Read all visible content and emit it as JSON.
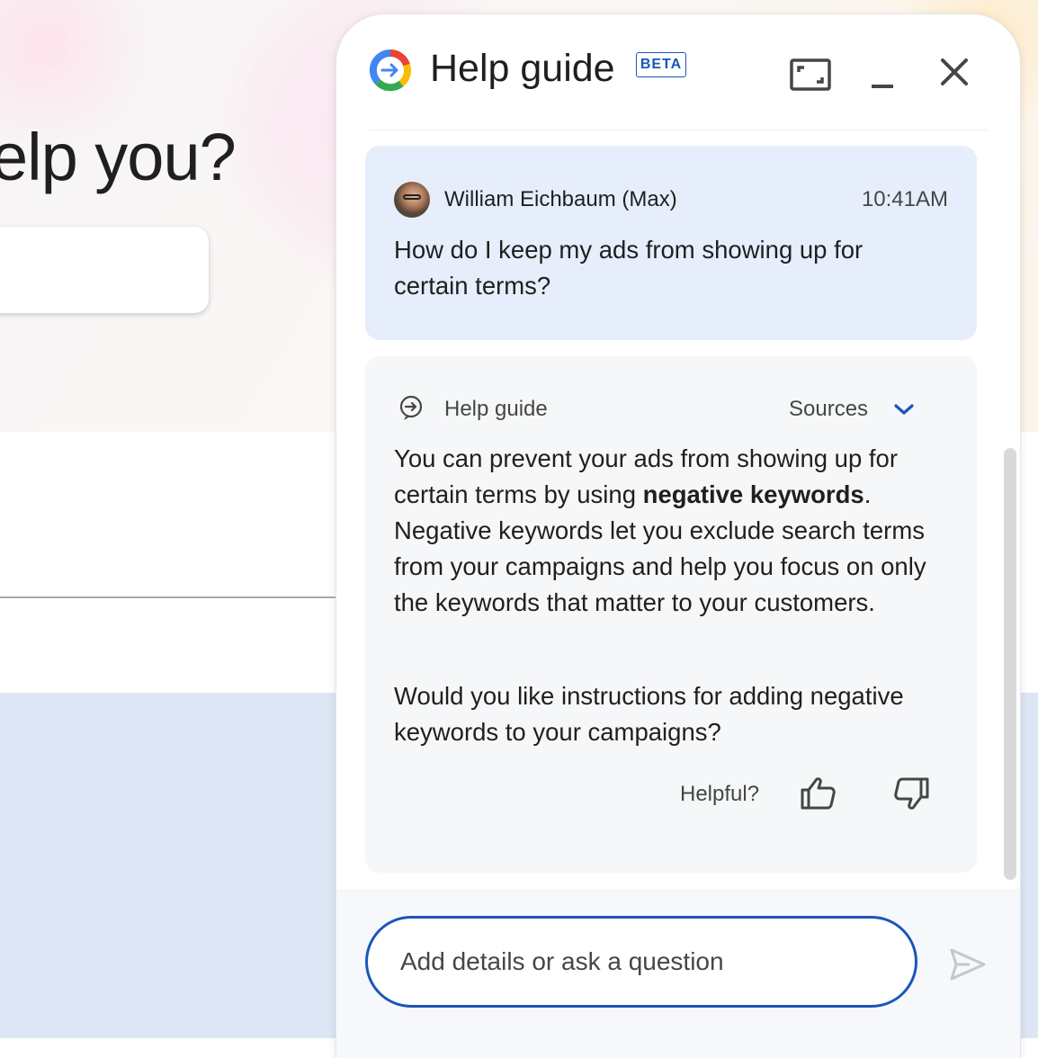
{
  "background": {
    "heading": "elp you?"
  },
  "panel": {
    "title": "Help guide",
    "badge": "BETA",
    "icons": {
      "logo": "google-logo-icon",
      "expand": "expand-icon",
      "minimize": "minimize-icon",
      "close": "close-icon"
    }
  },
  "user_message": {
    "name": "William Eichbaum (Max)",
    "time": "10:41AM",
    "text": "How do I keep my ads from showing up for certain terms?"
  },
  "bot_message": {
    "name": "Help guide",
    "sources_label": "Sources",
    "text_before": "You can prevent your ads from showing up for certain terms by using ",
    "bold": "negative keywords",
    "text_after": ". Negative keywords let you exclude search terms from your campaigns and help you focus on only the keywords that matter to your customers.",
    "followup": "Would you like instructions for adding negative keywords to your campaigns?",
    "feedback_label": "Helpful?"
  },
  "input": {
    "placeholder": "Add details or ask a question"
  },
  "colors": {
    "accent": "#1a56b8",
    "user_bubble": "#e6eefc",
    "bot_bubble": "#f6f7f9"
  }
}
